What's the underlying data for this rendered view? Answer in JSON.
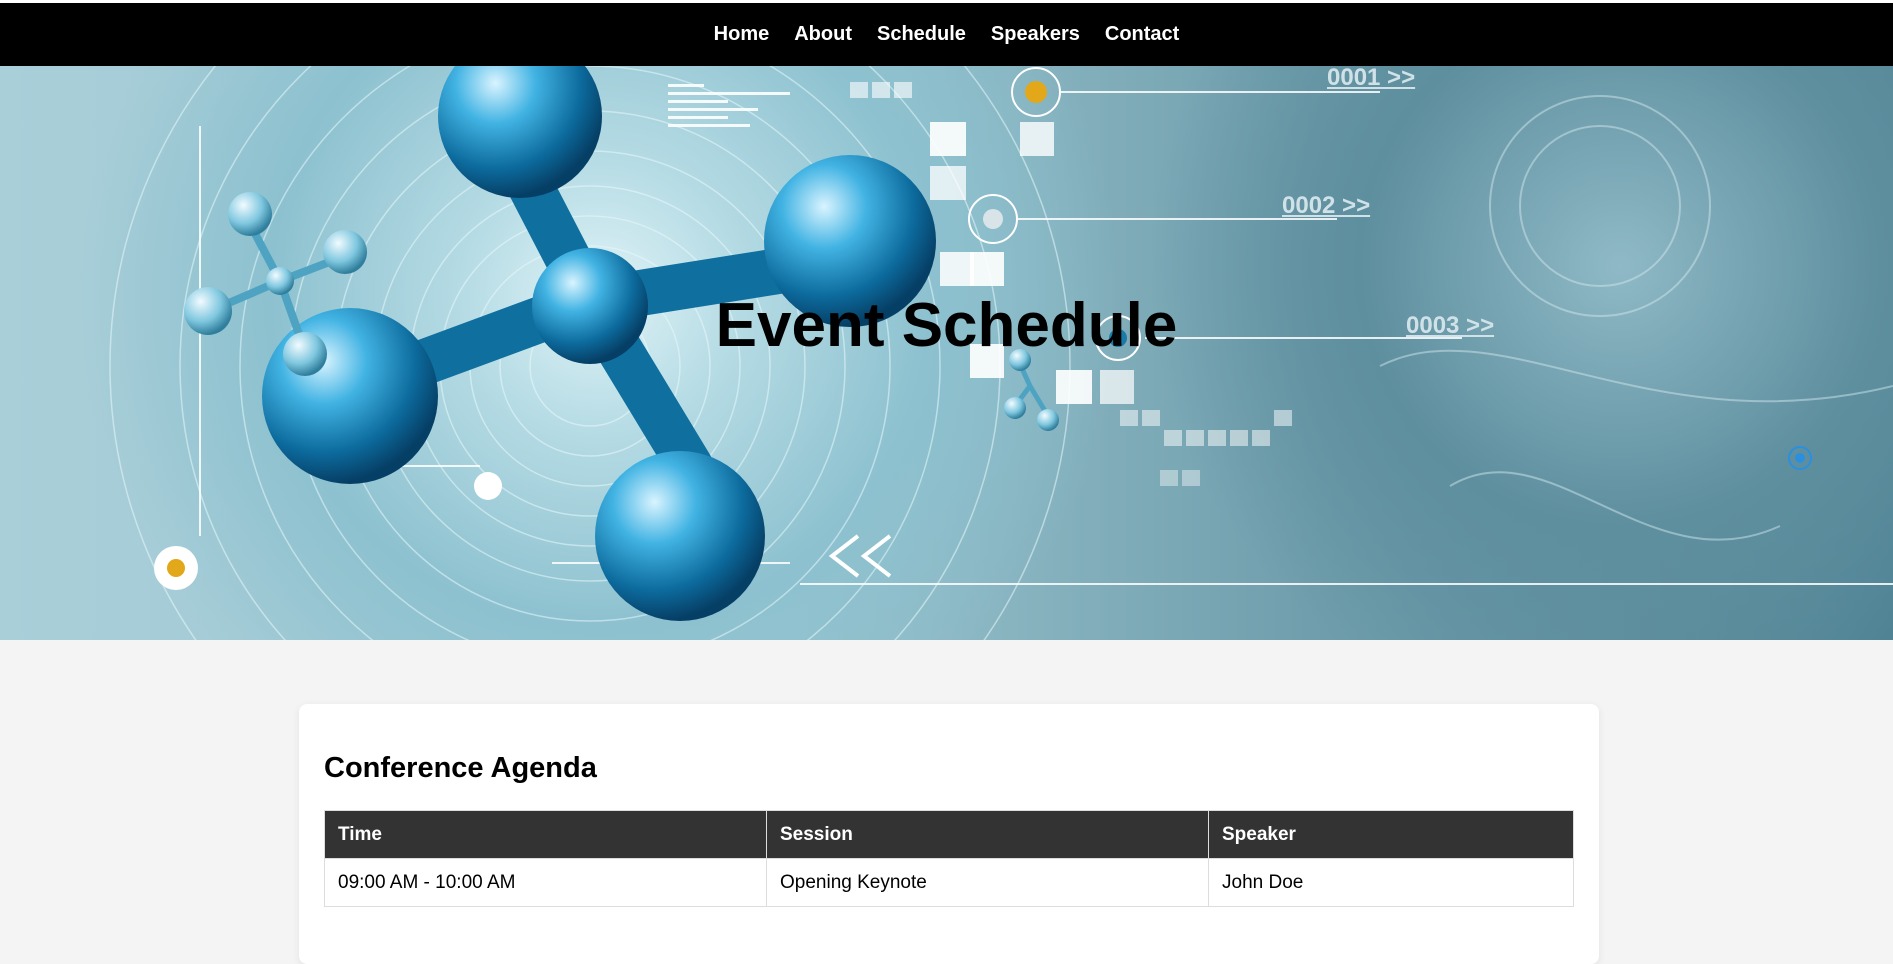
{
  "nav": {
    "items": [
      "Home",
      "About",
      "Schedule",
      "Speakers",
      "Contact"
    ]
  },
  "hero": {
    "title": "Event Schedule",
    "labels": [
      "0001 >>",
      "0002 >>",
      "0003 >>"
    ]
  },
  "agenda": {
    "title": "Conference Agenda",
    "columns": [
      "Time",
      "Session",
      "Speaker"
    ],
    "rows": [
      [
        "09:00 AM - 10:00 AM",
        "Opening Keynote",
        "John Doe"
      ]
    ]
  },
  "colors": {
    "nav_bg": "#000000",
    "table_header_bg": "#333333",
    "page_bg": "#f4f4f4",
    "molecule": "#1f8fc0"
  }
}
